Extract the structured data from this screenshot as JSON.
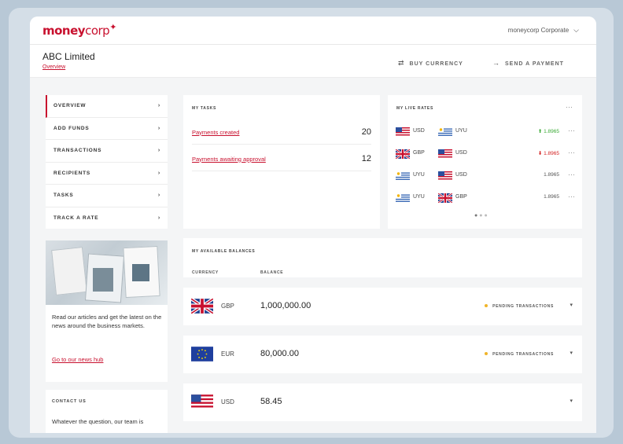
{
  "brand": {
    "logo_money": "money",
    "logo_corp": "corp"
  },
  "topbar": {
    "account_name": "moneycorp Corporate"
  },
  "header": {
    "company": "ABC Limited",
    "breadcrumb": "Overview",
    "buy_currency": "BUY CURRENCY",
    "send_payment": "SEND A PAYMENT"
  },
  "sidebar": {
    "items": [
      {
        "label": "OVERVIEW"
      },
      {
        "label": "ADD FUNDS"
      },
      {
        "label": "TRANSACTIONS"
      },
      {
        "label": "RECIPIENTS"
      },
      {
        "label": "TASKS"
      },
      {
        "label": "TRACK A RATE"
      }
    ]
  },
  "news": {
    "text": "Read our articles and get the latest on the news around the business markets.",
    "link": "Go to our news hub"
  },
  "contact": {
    "title": "CONTACT US",
    "text": "Whatever the question, our team is"
  },
  "tasks": {
    "title": "MY TASKS",
    "rows": [
      {
        "label": "Payments created",
        "count": "20"
      },
      {
        "label": "Payments awaiting approval",
        "count": "12"
      }
    ]
  },
  "rates": {
    "title": "MY LIVE RATES",
    "rows": [
      {
        "from": "USD",
        "to": "UYU",
        "value": "1.8965",
        "trend": "up"
      },
      {
        "from": "GBP",
        "to": "USD",
        "value": "1.8965",
        "trend": "down"
      },
      {
        "from": "UYU",
        "to": "USD",
        "value": "1.8965",
        "trend": "none"
      },
      {
        "from": "UYU",
        "to": "GBP",
        "value": "1.8965",
        "trend": "none"
      }
    ]
  },
  "balances": {
    "title": "MY AVAILABLE BALANCES",
    "col_currency": "CURRENCY",
    "col_balance": "BALANCE",
    "pending_label": "PENDING TRANSACTIONS",
    "rows": [
      {
        "currency": "GBP",
        "amount": "1,000,000.00"
      },
      {
        "currency": "EUR",
        "amount": "80,000.00"
      },
      {
        "currency": "USD",
        "amount": "58.45"
      }
    ]
  },
  "colors": {
    "brand_red": "#c8102e",
    "up_green": "#3aaa35",
    "down_red": "#d31f1f",
    "pending_yellow": "#f0b429"
  }
}
